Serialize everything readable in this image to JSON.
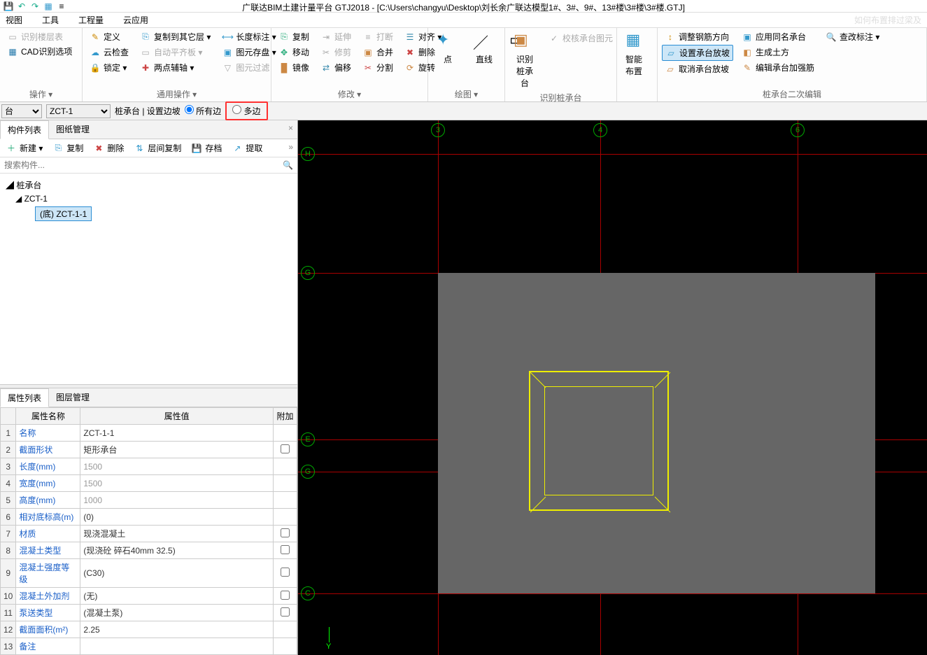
{
  "title": "广联达BIM土建计量平台 GTJ2018 - [C:\\Users\\changyu\\Desktop\\刘长余广联达模型1#、3#、9#、13#楼\\3#楼\\3#楼.GTJ]",
  "watermark": "如何布置排过梁及",
  "menu": {
    "view": "视图",
    "tool": "工具",
    "quantity": "工程量",
    "cloud": "云应用"
  },
  "ribbon": {
    "g1": {
      "a": "识别楼层表",
      "b": "CAD识别选项",
      "label": "操作 ▾"
    },
    "g2": {
      "a": "定义",
      "b": "云检查",
      "c": "锁定 ▾",
      "d": "复制到其它层 ▾",
      "e": "自动平齐板 ▾",
      "f": "两点辅轴 ▾",
      "g": "长度标注 ▾",
      "h": "图元存盘 ▾",
      "i": "图元过滤",
      "label": "通用操作 ▾"
    },
    "g3": {
      "a": "复制",
      "b": "移动",
      "c": "镜像",
      "d": "延伸",
      "e": "修剪",
      "f": "偏移",
      "g": "打断",
      "h": "合并",
      "i": "分割",
      "j": "对齐 ▾",
      "k": "删除",
      "l": "旋转",
      "label": "修改 ▾"
    },
    "g4": {
      "a": "点",
      "b": "直线",
      "c": "",
      "label": "绘图 ▾"
    },
    "g5": {
      "a": "识别桩承台",
      "b": "校核承台图元",
      "label": "识别桩承台"
    },
    "g6": {
      "a": "智能布置",
      "label": ""
    },
    "g7": {
      "a": "调整钢筋方向",
      "b": "设置承台放坡",
      "c": "取消承台放坡",
      "d": "应用同名承台",
      "e": "生成土方",
      "f": "编辑承台加强筋",
      "g": "查改标注 ▾",
      "label": "桩承台二次编辑"
    }
  },
  "optbar": {
    "sel1": "台",
    "sel2": "ZCT-1",
    "lbl": "桩承台 | 设置边坡",
    "r1": "所有边",
    "r2": "多边"
  },
  "tabs": {
    "components": "构件列表",
    "drawings": "图纸管理"
  },
  "ctoolbar": {
    "new": "新建 ▾",
    "copy": "复制",
    "del": "删除",
    "layercopy": "层间复制",
    "save": "存档",
    "extract": "提取"
  },
  "search_ph": "搜索构件...",
  "tree": {
    "root": "桩承台",
    "c1": "ZCT-1",
    "c2": "(底)  ZCT-1-1"
  },
  "proptabs": {
    "a": "属性列表",
    "b": "图层管理"
  },
  "prophdr": {
    "name": "属性名称",
    "val": "属性值",
    "extra": "附加"
  },
  "props": [
    {
      "n": "1",
      "k": "名称",
      "v": "ZCT-1-1"
    },
    {
      "n": "2",
      "k": "截面形状",
      "v": "矩形承台"
    },
    {
      "n": "3",
      "k": "长度(mm)",
      "v": "1500",
      "g": true
    },
    {
      "n": "4",
      "k": "宽度(mm)",
      "v": "1500",
      "g": true
    },
    {
      "n": "5",
      "k": "高度(mm)",
      "v": "1000",
      "g": true
    },
    {
      "n": "6",
      "k": "相对底标高(m)",
      "v": "(0)"
    },
    {
      "n": "7",
      "k": "材质",
      "v": "现浇混凝土"
    },
    {
      "n": "8",
      "k": "混凝土类型",
      "v": "(现浇砼 碎石40mm 32.5)"
    },
    {
      "n": "9",
      "k": "混凝土强度等级",
      "v": "(C30)"
    },
    {
      "n": "10",
      "k": "混凝土外加剂",
      "v": "(无)"
    },
    {
      "n": "11",
      "k": "泵送类型",
      "v": "(混凝土泵)"
    },
    {
      "n": "12",
      "k": "截面面积(m²)",
      "v": "2.25"
    },
    {
      "n": "13",
      "k": "备注",
      "v": ""
    }
  ],
  "gridlabels": {
    "c3": "3",
    "c4": "4",
    "c6": "6",
    "rH": "H",
    "rG": "G",
    "rE": "E",
    "rG2": "G",
    "rC": "C"
  },
  "axis": "Y"
}
